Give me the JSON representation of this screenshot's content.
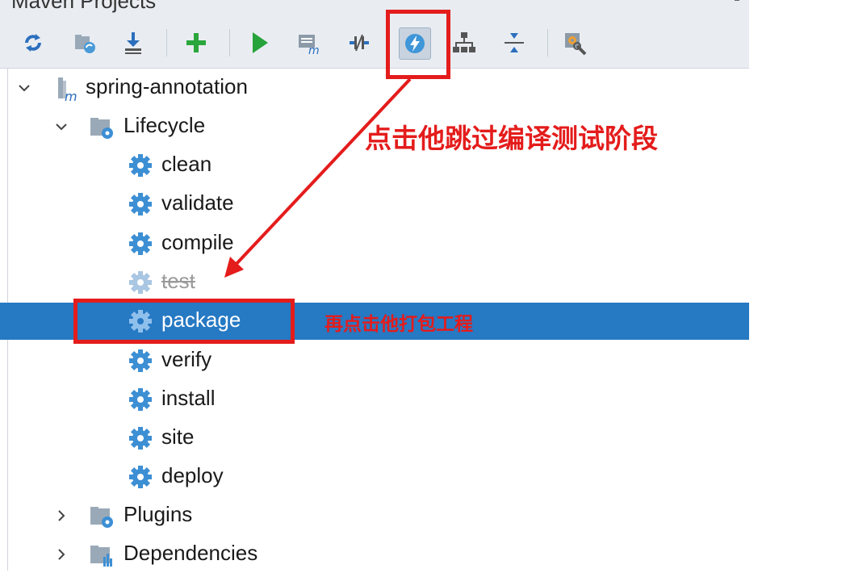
{
  "panel": {
    "title": "Maven Projects"
  },
  "toolbar": {
    "buttons": [
      {
        "name": "reimport-icon"
      },
      {
        "name": "generate-sources-icon"
      },
      {
        "name": "download-icon"
      },
      {
        "name": "add-icon"
      },
      {
        "name": "run-icon"
      },
      {
        "name": "execute-goal-icon"
      },
      {
        "name": "toggle-offline-icon"
      },
      {
        "name": "skip-tests-icon"
      },
      {
        "name": "show-dependencies-icon"
      },
      {
        "name": "collapse-all-icon"
      },
      {
        "name": "settings-icon"
      }
    ]
  },
  "tree": {
    "project": "spring-annotation",
    "lifecycle_label": "Lifecycle",
    "phases": [
      "clean",
      "validate",
      "compile",
      "test",
      "package",
      "verify",
      "install",
      "site",
      "deploy"
    ],
    "disabled_phase": "test",
    "selected_phase": "package",
    "plugins_label": "Plugins",
    "dependencies_label": "Dependencies"
  },
  "annotations": {
    "note1": "点击他跳过编译测试阶段",
    "note2": "再点击他打包工程"
  },
  "colors": {
    "selection": "#2679c3",
    "annotation": "#e41c1c",
    "gear": "#3d8fd4"
  }
}
